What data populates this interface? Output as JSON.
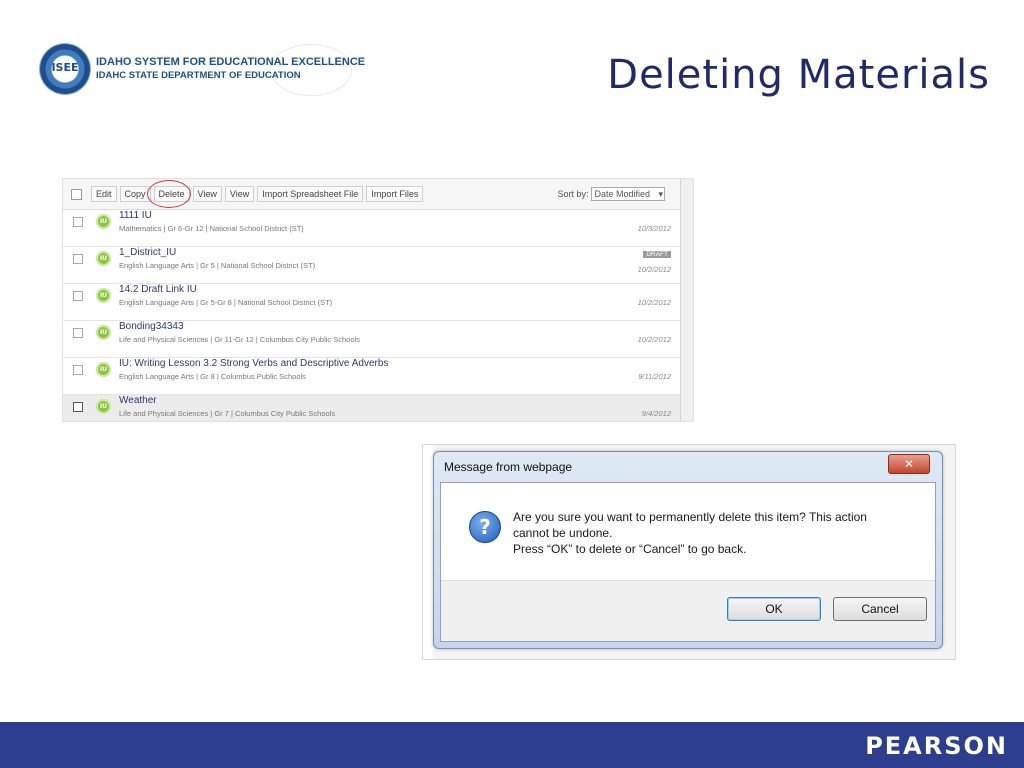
{
  "header": {
    "logo_seal_text": "ISEE",
    "logo_line1": "IDAHO SYSTEM FOR EDUCATIONAL EXCELLENCE",
    "logo_line2": "IDAHC STATE DEPARTMENT OF EDUCATION",
    "page_title": "Deleting Materials"
  },
  "list_screenshot": {
    "toolbar": {
      "buttons": [
        "Edit",
        "Copy",
        "Delete",
        "View",
        "View",
        "Import Spreadsheet File",
        "Import Files"
      ],
      "sort_label": "Sort by:",
      "sort_value": "Date Modified"
    },
    "rows": [
      {
        "title": "1111 IU",
        "meta": "Mathematics  |  Gr 6-Gr 12  |  National School District (ST)",
        "date": "10/3/2012",
        "draft": "",
        "selected": false
      },
      {
        "title": "1_District_IU",
        "meta": "English Language Arts  |  Gr 5  |  National School District (ST)",
        "date": "10/2/2012",
        "draft": "DRAFT",
        "selected": false
      },
      {
        "title": "14.2 Draft Link IU",
        "meta": "English Language Arts  |  Gr 5-Gr 8  |  National School District (ST)",
        "date": "10/2/2012",
        "draft": "",
        "selected": false
      },
      {
        "title": "Bonding34343",
        "meta": "Life and Physical Sciences  |  Gr 11-Gr 12  |  Columbus City Public Schools",
        "date": "10/2/2012",
        "draft": "",
        "selected": false
      },
      {
        "title": "IU: Writing Lesson 3.2 Strong Verbs and Descriptive Adverbs",
        "meta": "English Language Arts  |  Gr 8  |  Columbus Public Schools",
        "date": "9/11/2012",
        "draft": "",
        "selected": false
      },
      {
        "title": "Weather",
        "meta": "Life and Physical Sciences  |  Gr 7  |  Columbus City Public Schools",
        "date": "9/4/2012",
        "draft": "",
        "selected": true
      }
    ]
  },
  "dialog": {
    "title": "Message from webpage",
    "close_glyph": "✕",
    "icon_glyph": "?",
    "message_line1": "Are you sure you want to permanently delete this item? This action",
    "message_line2": "cannot be undone.",
    "message_line3": "Press “OK” to delete or “Cancel” to go back.",
    "ok_label": "OK",
    "cancel_label": "Cancel"
  },
  "footer": {
    "brand": "PEARSON"
  }
}
